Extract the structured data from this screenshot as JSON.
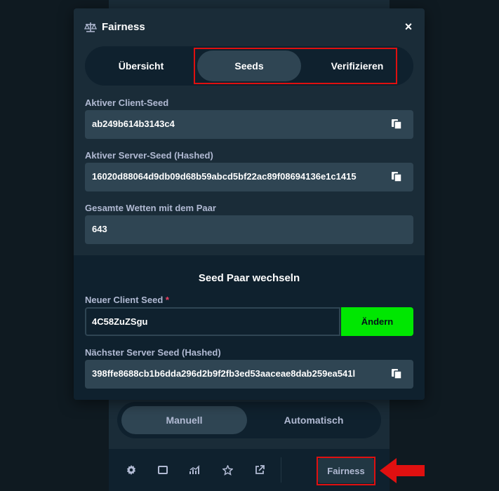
{
  "modal": {
    "title": "Fairness",
    "close_label": "×",
    "tabs": [
      {
        "label": "Übersicht"
      },
      {
        "label": "Seeds"
      },
      {
        "label": "Verifizieren"
      }
    ],
    "active_tab": "Seeds",
    "fields": {
      "client_seed": {
        "label": "Aktiver Client-Seed",
        "value": "ab249b614b3143c4"
      },
      "server_seed": {
        "label": "Aktiver Server-Seed (Hashed)",
        "value": "16020d88064d9db09d68b59abcd5bf22ac89f08694136e1c1415"
      },
      "total_bets": {
        "label": "Gesamte Wetten mit dem Paar",
        "value": "643"
      }
    },
    "change_pair": {
      "title": "Seed Paar wechseln",
      "new_client_seed_label": "Neuer Client Seed",
      "required_mark": "*",
      "new_client_seed_value": "4C58ZuZSgu",
      "change_button": "Ändern",
      "next_server_seed_label": "Nächster Server Seed (Hashed)",
      "next_server_seed_value": "398ffe8688cb1b6dda296d2b9f2fb3ed53aaceae8dab259ea541l"
    }
  },
  "background": {
    "modes": [
      {
        "label": "Manuell"
      },
      {
        "label": "Automatisch"
      }
    ],
    "footer": {
      "icons": [
        "gear-icon",
        "theater-mode-icon",
        "stats-icon",
        "star-icon",
        "popout-icon"
      ],
      "fairness_button": "Fairness"
    }
  },
  "colors": {
    "highlight": "#e01010",
    "accent_green": "#00e701",
    "modal_bg": "#1a2c38",
    "input_bg": "#2f4553"
  }
}
